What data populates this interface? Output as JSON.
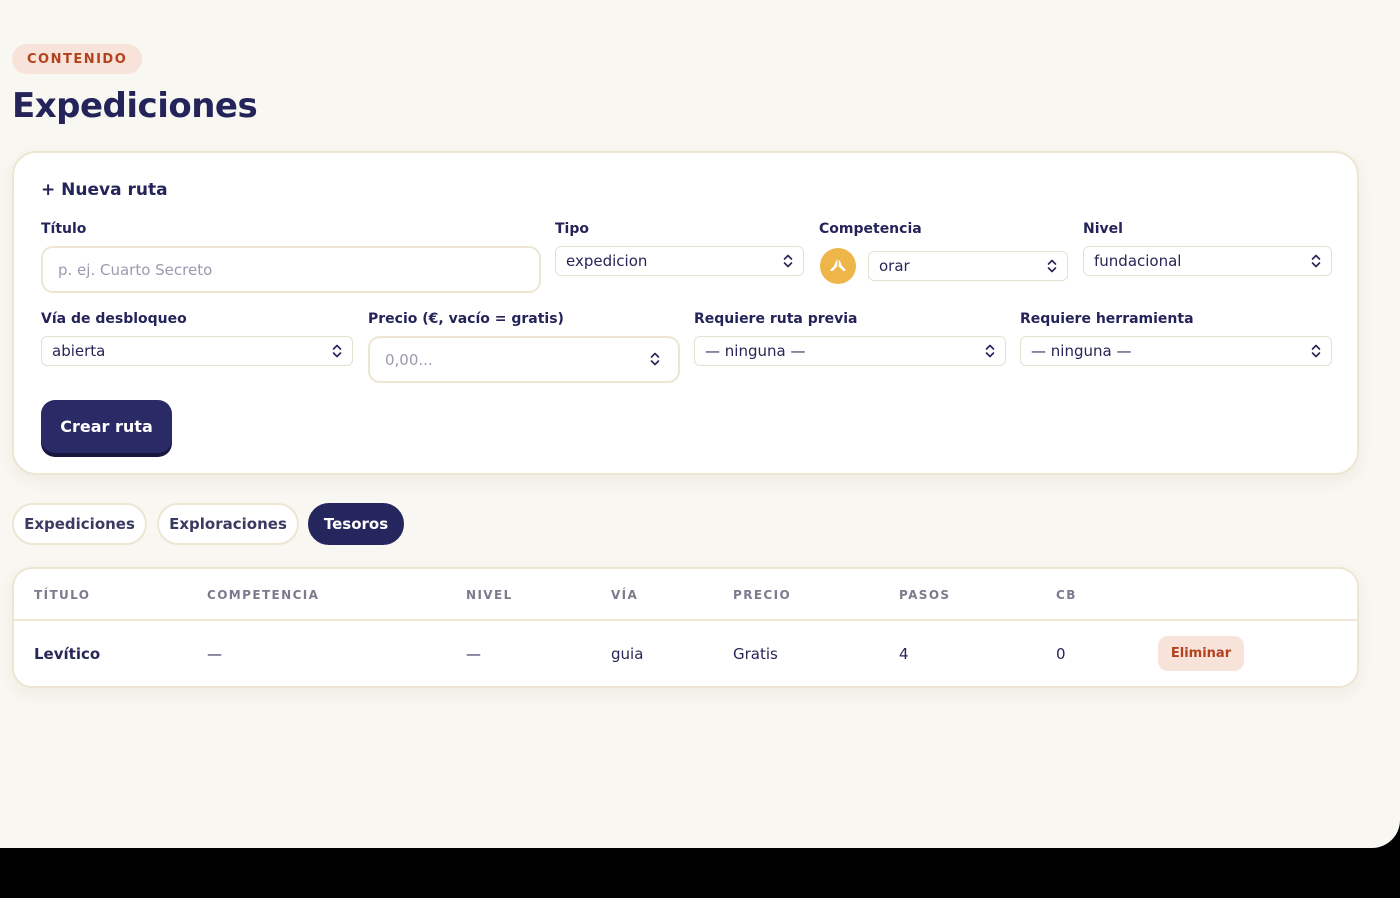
{
  "header": {
    "eyebrow": "CONTENIDO",
    "title": "Expediciones"
  },
  "form": {
    "title": "+ Nueva ruta",
    "titulo": {
      "label": "Título",
      "placeholder": "p. ej. Cuarto Secreto",
      "value": ""
    },
    "tipo": {
      "label": "Tipo",
      "value": "expedicion"
    },
    "competencia": {
      "label": "Competencia",
      "value": "orar",
      "icon": "praying-hands-icon",
      "icon_color": "#eeb548"
    },
    "nivel": {
      "label": "Nivel",
      "value": "fundacional"
    },
    "via": {
      "label": "Vía de desbloqueo",
      "value": "abierta"
    },
    "precio": {
      "label": "Precio (€, vacío = gratis)",
      "placeholder": "0,00..."
    },
    "ruta_previa": {
      "label": "Requiere ruta previa",
      "value": "— ninguna —"
    },
    "herramienta": {
      "label": "Requiere herramienta",
      "value": "— ninguna —"
    },
    "submit_label": "Crear ruta"
  },
  "tabs": [
    {
      "label": "Expediciones",
      "active": false
    },
    {
      "label": "Exploraciones",
      "active": false
    },
    {
      "label": "Tesoros",
      "active": true
    }
  ],
  "table": {
    "columns": [
      "TÍTULO",
      "COMPETENCIA",
      "NIVEL",
      "VÍA",
      "PRECIO",
      "PASOS",
      "CB"
    ],
    "rows": [
      {
        "titulo": "Levítico",
        "competencia": "—",
        "nivel": "—",
        "via": "guia",
        "precio": "Gratis",
        "pasos": "4",
        "cb": "0",
        "action": "Eliminar"
      }
    ]
  },
  "colors": {
    "accent": "#26265e",
    "background": "#f9f7f1",
    "danger_text": "#b3411d",
    "danger_bg": "#f8e3da"
  }
}
